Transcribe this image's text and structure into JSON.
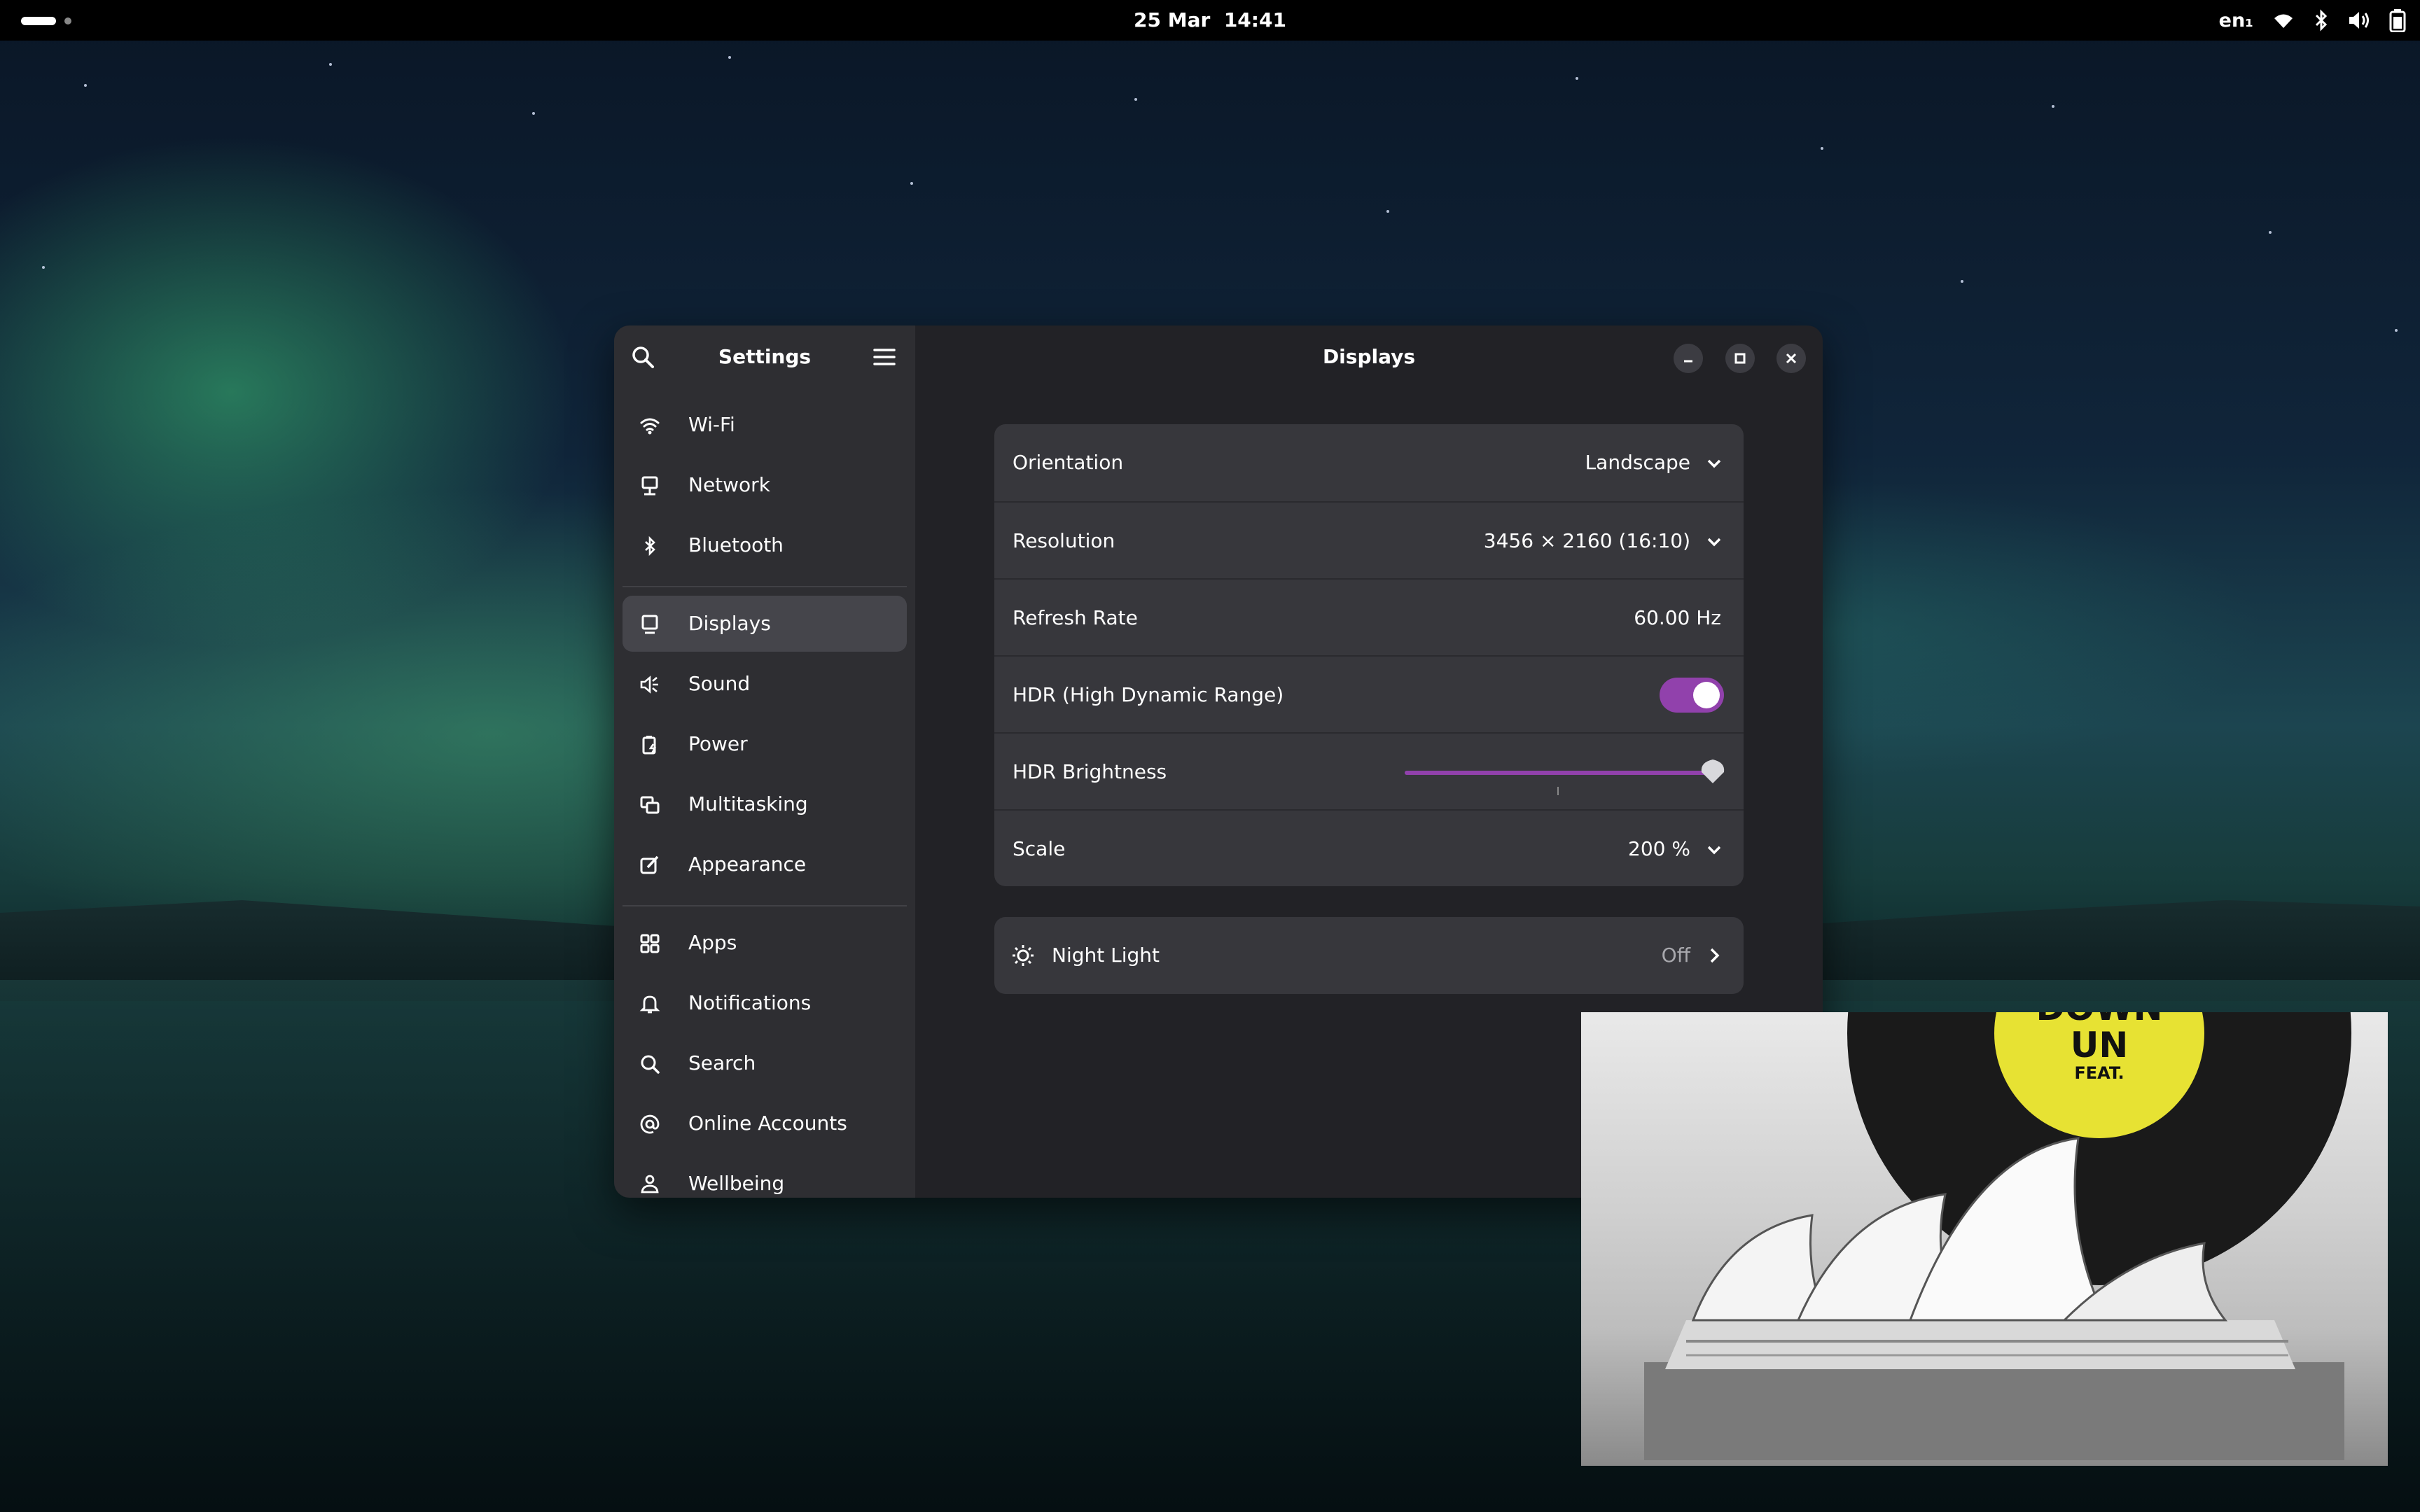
{
  "topbar": {
    "date": "25 Mar",
    "time": "14:41",
    "keyboard_layout": "en₁",
    "tray_icons": [
      "wifi-icon",
      "bluetooth-icon",
      "volume-icon",
      "battery-icon"
    ]
  },
  "window": {
    "sidebar_title": "Settings",
    "content_title": "Displays",
    "controls": [
      "minimize-icon",
      "maximize-icon",
      "close-icon"
    ]
  },
  "sidebar": {
    "items": [
      {
        "label": "Wi-Fi",
        "icon": "wifi-icon"
      },
      {
        "label": "Network",
        "icon": "network-icon"
      },
      {
        "label": "Bluetooth",
        "icon": "bluetooth-icon"
      },
      {
        "label": "Displays",
        "icon": "display-icon",
        "active": true
      },
      {
        "label": "Sound",
        "icon": "sound-icon"
      },
      {
        "label": "Power",
        "icon": "power-icon"
      },
      {
        "label": "Multitasking",
        "icon": "multitasking-icon"
      },
      {
        "label": "Appearance",
        "icon": "appearance-icon"
      },
      {
        "label": "Apps",
        "icon": "apps-icon"
      },
      {
        "label": "Notifications",
        "icon": "bell-icon"
      },
      {
        "label": "Search",
        "icon": "search-icon"
      },
      {
        "label": "Online Accounts",
        "icon": "at-icon"
      },
      {
        "label": "Wellbeing",
        "icon": "wellbeing-icon"
      }
    ]
  },
  "displays": {
    "orientation": {
      "label": "Orientation",
      "value": "Landscape"
    },
    "resolution": {
      "label": "Resolution",
      "value": "3456 × 2160 (16:10)"
    },
    "refresh_rate": {
      "label": "Refresh Rate",
      "value": "60.00 Hz"
    },
    "hdr": {
      "label": "HDR (High Dynamic Range)",
      "enabled": true
    },
    "hdr_brightness": {
      "label": "HDR Brightness",
      "level": 1.0
    },
    "scale": {
      "label": "Scale",
      "value": "200 %"
    },
    "night_light": {
      "label": "Night Light",
      "value": "Off"
    }
  },
  "colors": {
    "accent": "#9141ac",
    "window_bg": "#222226",
    "sidebar_bg": "#2e2e32",
    "card_bg": "#37373c"
  },
  "album_art": {
    "label_line1": "DOWN",
    "label_line2": "UN",
    "label_line3": "FEAT."
  }
}
